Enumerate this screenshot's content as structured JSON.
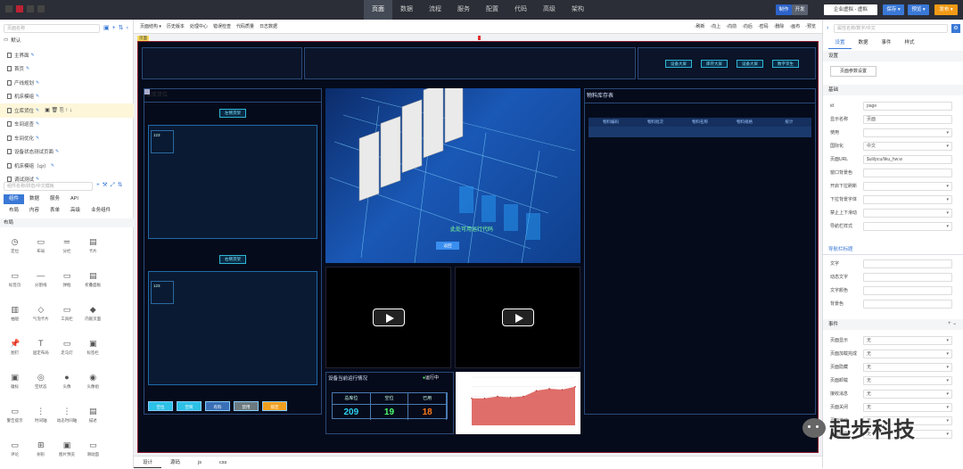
{
  "topbar": {
    "menus": [
      "页面",
      "数据",
      "流程",
      "服务",
      "配置",
      "代码",
      "高级",
      "架构"
    ],
    "active_menu": "页面",
    "mode_btns": [
      "制作",
      "开发"
    ],
    "env": "企业虚拟 - 虚拟",
    "save": "保存",
    "preview": "预览",
    "publish": "发布"
  },
  "left": {
    "search_placeholder": "页面名称",
    "group": "默认",
    "pages": [
      "主界面",
      "首页",
      "产线规划",
      "机床模组",
      "立库货位",
      "车间巡查",
      "车间优化",
      "设备状态测试页面",
      "机床模组（cjr）",
      "调试测试"
    ],
    "selected_page": "立库货位",
    "comp_search_placeholder": "组件名称/拼音/中文模板",
    "tabs1": [
      "组件",
      "数据",
      "服务",
      "API"
    ],
    "tabs2": [
      "布局",
      "内容",
      "表单",
      "高级",
      "业务组件"
    ],
    "section": "布局",
    "components": [
      {
        "label": "定位",
        "icon": "clock-icon",
        "glyph": "◷"
      },
      {
        "label": "布局",
        "icon": "layout-icon",
        "glyph": "▭"
      },
      {
        "label": "分栏",
        "icon": "columns-icon",
        "glyph": "═"
      },
      {
        "label": "卡片",
        "icon": "card-icon",
        "glyph": "▤"
      },
      {
        "label": "",
        "icon": "blank-icon",
        "glyph": ""
      },
      {
        "label": "标签页",
        "icon": "tabs-icon",
        "glyph": "▭"
      },
      {
        "label": "分割线",
        "icon": "divider-icon",
        "glyph": "—"
      },
      {
        "label": "弹框",
        "icon": "dialog-icon",
        "glyph": "▭"
      },
      {
        "label": "折叠面板",
        "icon": "collapse-icon",
        "glyph": "▤"
      },
      {
        "label": "",
        "icon": "blank-icon",
        "glyph": ""
      },
      {
        "label": "抽屉",
        "icon": "drawer-icon",
        "glyph": "▥"
      },
      {
        "label": "气泡卡片",
        "icon": "bubble-icon",
        "glyph": "◇"
      },
      {
        "label": "工具栏",
        "icon": "toolbar-icon",
        "glyph": "▭"
      },
      {
        "label": "内嵌页面",
        "icon": "embed-icon",
        "glyph": "◆"
      },
      {
        "label": "",
        "icon": "blank-icon",
        "glyph": ""
      },
      {
        "label": "图钉",
        "icon": "pin-icon",
        "glyph": "📌"
      },
      {
        "label": "固定布局",
        "icon": "fixed-icon",
        "glyph": "T"
      },
      {
        "label": "走马灯",
        "icon": "carousel-icon",
        "glyph": "▭"
      },
      {
        "label": "标签栏",
        "icon": "tagbar-icon",
        "glyph": "▣"
      },
      {
        "label": "",
        "icon": "blank-icon",
        "glyph": ""
      },
      {
        "label": "徽标",
        "icon": "badge-icon",
        "glyph": "▣"
      },
      {
        "label": "空状态",
        "icon": "empty-icon",
        "glyph": "◎"
      },
      {
        "label": "头像",
        "icon": "avatar-icon",
        "glyph": "●"
      },
      {
        "label": "头像组",
        "icon": "avatar-group-icon",
        "glyph": "◉"
      },
      {
        "label": "",
        "icon": "blank-icon",
        "glyph": ""
      },
      {
        "label": "警告提示",
        "icon": "alert-icon",
        "glyph": "▭"
      },
      {
        "label": "时间轴",
        "icon": "timeline-icon",
        "glyph": "⋮"
      },
      {
        "label": "动态时间轴",
        "icon": "dyn-timeline-icon",
        "glyph": "⋮"
      },
      {
        "label": "描述",
        "icon": "desc-icon",
        "glyph": "▤"
      },
      {
        "label": "",
        "icon": "blank-icon",
        "glyph": ""
      },
      {
        "label": "评论",
        "icon": "comment-icon",
        "glyph": "▭"
      },
      {
        "label": "树形",
        "icon": "tree-icon",
        "glyph": "⊞"
      },
      {
        "label": "图片预览",
        "icon": "image-preview-icon",
        "glyph": "▣"
      },
      {
        "label": "滑动面",
        "icon": "slide-icon",
        "glyph": "▭"
      },
      {
        "label": "",
        "icon": "blank-icon",
        "glyph": ""
      }
    ]
  },
  "canvas": {
    "toolbar_left": [
      "页面结构 ▾",
      "历史版本",
      "处理中心",
      "错误检查",
      "代码质量",
      "日志数据"
    ],
    "toolbar_right": [
      "刷新",
      "向上",
      "向前",
      "向后",
      "密码",
      "删除",
      "画布",
      "预览"
    ],
    "page_tag": "页面",
    "header_btns": [
      "设备大屏",
      "库存大屏",
      "设备大屏",
      "数字孪生"
    ],
    "panel_left_title": "立库货位",
    "left_sub1": "左侧货架",
    "left_sub2": "右侧货架",
    "cell_text": "123",
    "status_btns": [
      {
        "label": "空位",
        "color": "#2cc1e6"
      },
      {
        "label": "空筒",
        "color": "#2cc1e6"
      },
      {
        "label": "有料",
        "color": "#3a6fb5"
      },
      {
        "label": "禁用",
        "color": "#6c7a80"
      },
      {
        "label": "锁定",
        "color": "#f0a020"
      }
    ],
    "panel_right_title": "物料库存表",
    "table_headers": [
      "物料编码",
      "物料批次",
      "物料名称",
      "物料规格",
      "统计"
    ],
    "scene_caption": "此处可用运行代码",
    "scene_button": "返回",
    "device_title": "设备当前运行情况",
    "device_status": "运行中",
    "stat_headers": [
      "总库位",
      "空位",
      "已用"
    ],
    "stat_values": [
      {
        "v": "209",
        "color": "#2fd0f0"
      },
      {
        "v": "19",
        "color": "#4cff70"
      },
      {
        "v": "18",
        "color": "#ff7a1a"
      }
    ],
    "bottom_tabs": [
      "设计",
      "源码",
      "js",
      "css"
    ]
  },
  "chart_data": {
    "type": "area",
    "x": [
      1,
      2,
      3,
      4,
      5,
      6,
      7,
      8,
      9
    ],
    "values": [
      28,
      28,
      30,
      29,
      30,
      36,
      38,
      37,
      40
    ],
    "ylim": [
      0,
      50
    ],
    "color": "#d9534f"
  },
  "right": {
    "search_placeholder": "属性名称/数字/中文",
    "tabs": [
      "设置",
      "数据",
      "事件",
      "样式"
    ],
    "sec_setting": "设置",
    "page_param_btn": "页面参数设置",
    "sec_basic": "基础",
    "props": [
      {
        "label": "id",
        "value": "page",
        "select": false
      },
      {
        "label": "显示名称",
        "value": "页面",
        "select": false
      },
      {
        "label": "使用",
        "value": "",
        "select": true
      },
      {
        "label": "国际化",
        "value": "中文",
        "select": true
      },
      {
        "label": "页面URL",
        "value": "$uli/pcu/liku_hw.w",
        "select": false
      },
      {
        "label": "窗口背景色",
        "value": "",
        "select": false
      },
      {
        "label": "开启下拉刷新",
        "value": "",
        "select": true
      },
      {
        "label": "下拉背景字体",
        "value": "",
        "select": true
      },
      {
        "label": "禁止上下滑动",
        "value": "",
        "select": true
      },
      {
        "label": "导航栏样式",
        "value": "",
        "select": true
      }
    ],
    "sec_nav": "导航栏标题",
    "nav_props": [
      {
        "label": "文字",
        "value": ""
      },
      {
        "label": "动态文字",
        "value": ""
      },
      {
        "label": "文字颜色",
        "value": ""
      },
      {
        "label": "背景色",
        "value": ""
      }
    ],
    "sec_event": "事件",
    "events": [
      {
        "label": "页面显示",
        "value": "无"
      },
      {
        "label": "页面加载完成",
        "value": "无"
      },
      {
        "label": "页面隐藏",
        "value": "无"
      },
      {
        "label": "页面卸载",
        "value": "无"
      },
      {
        "label": "接收消息",
        "value": "无"
      },
      {
        "label": "页面关闭",
        "value": "无"
      },
      {
        "label": "页面滚动",
        "value": "无"
      },
      {
        "label": "上拉触底",
        "value": "无"
      }
    ]
  },
  "watermark": "起步科技"
}
